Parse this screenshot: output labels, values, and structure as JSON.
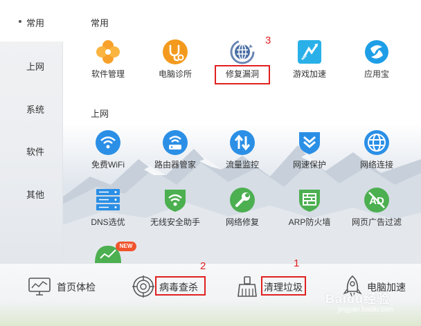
{
  "sidebar": {
    "items": [
      {
        "label": "常用"
      },
      {
        "label": "上网"
      },
      {
        "label": "系统"
      },
      {
        "label": "软件"
      },
      {
        "label": "其他"
      }
    ]
  },
  "sections": {
    "common": {
      "title": "常用",
      "tools": [
        {
          "label": "软件管理",
          "icon": "flower-icon",
          "color": "#f7a12a"
        },
        {
          "label": "电脑诊所",
          "icon": "stethoscope-icon",
          "color": "#f39a1e"
        },
        {
          "label": "修复漏洞",
          "icon": "shield-refresh-icon",
          "color": "#6a86b4"
        },
        {
          "label": "游戏加速",
          "icon": "game-boost-icon",
          "color": "#2ab0e8"
        },
        {
          "label": "应用宝",
          "icon": "app-store-icon",
          "color": "#1d9ee6"
        }
      ]
    },
    "internet": {
      "title": "上网",
      "tools": [
        {
          "label": "免费WiFi",
          "icon": "wifi-icon",
          "color": "#2b8fe6"
        },
        {
          "label": "路由器管家",
          "icon": "router-icon",
          "color": "#2b8fe6"
        },
        {
          "label": "流量监控",
          "icon": "traffic-arrows-icon",
          "color": "#2b8fe6"
        },
        {
          "label": "网速保护",
          "icon": "speed-shield-icon",
          "color": "#2b8fe6"
        },
        {
          "label": "网络连接",
          "icon": "globe-icon",
          "color": "#2b8fe6"
        },
        {
          "label": "DNS选优",
          "icon": "dns-server-icon",
          "color": "#2b8fe6"
        },
        {
          "label": "无线安全助手",
          "icon": "wifi-shield-icon",
          "color": "#4caf50"
        },
        {
          "label": "网络修复",
          "icon": "wrench-icon",
          "color": "#4caf50"
        },
        {
          "label": "ARP防火墙",
          "icon": "firewall-icon",
          "color": "#4caf50"
        },
        {
          "label": "网页广告过滤",
          "icon": "ad-block-icon",
          "color": "#4caf50"
        }
      ],
      "partial_tool_badge": "NEW"
    }
  },
  "annotations": {
    "common_fix_number": "3",
    "bottom_virus_number": "2",
    "bottom_clean_number": "1"
  },
  "bottom_bar": {
    "items": [
      {
        "label": "首页体检",
        "icon": "monitor-chart-icon"
      },
      {
        "label": "病毒查杀",
        "icon": "target-icon"
      },
      {
        "label": "清理垃圾",
        "icon": "broom-icon"
      },
      {
        "label": "电脑加速",
        "icon": "rocket-icon"
      }
    ]
  },
  "watermark": {
    "text": "Baidu经验",
    "url": "jingyan.baidu.com"
  },
  "colors": {
    "highlight": "#e02020",
    "orange": "#f7a12a",
    "blue": "#2b8fe6",
    "green": "#4caf50"
  }
}
